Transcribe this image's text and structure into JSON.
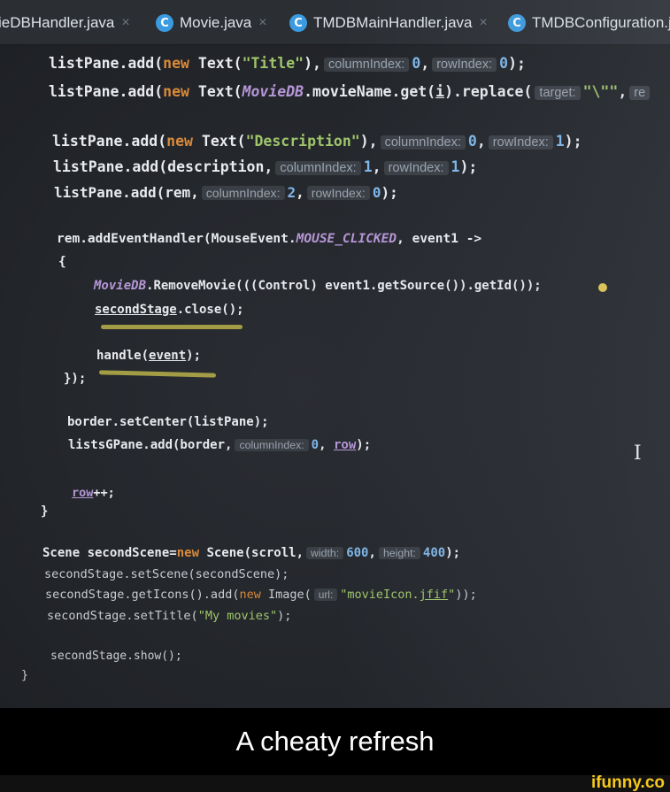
{
  "tabs": [
    {
      "label": "ieDBHandler.java"
    },
    {
      "icon": "C",
      "label": "Movie.java"
    },
    {
      "icon": "C",
      "label": "TMDBMainHandler.java"
    },
    {
      "icon": "C",
      "label": "TMDBConfiguration.j"
    }
  ],
  "tab_close": "×",
  "code": {
    "l1": {
      "a": "listPane.add(",
      "kw": "new",
      "b": " Text(",
      "s": "\"Title\"",
      "c": "),",
      "h1": "columnIndex:",
      "n1": "0",
      "d": ",",
      "h2": "rowIndex:",
      "n2": "0",
      "e": ");"
    },
    "l2": {
      "a": "listPane.add(",
      "kw": "new",
      "b": " Text(",
      "it": "MovieDB",
      "c": ".movieName.get(",
      "u": "i",
      "d": ").replace(",
      "h1": "target:",
      "s": "\"\\\"\"",
      "e": ",",
      "h2": "re"
    },
    "l3": {
      "a": "listPane.add(",
      "kw": "new",
      "b": " Text(",
      "s": "\"Description\"",
      "c": "),",
      "h1": "columnIndex:",
      "n1": "0",
      "d": ",",
      "h2": "rowIndex:",
      "n2": "1",
      "e": ");"
    },
    "l4": {
      "a": "listPane.add(description,",
      "h1": "columnIndex:",
      "n1": "1",
      "b": ",",
      "h2": "rowIndex:",
      "n2": "1",
      "e": ");"
    },
    "l5": {
      "a": "listPane.add(rem,",
      "h1": "columnIndex:",
      "n1": "2",
      "b": ",",
      "h2": "rowIndex:",
      "n2": "0",
      "e": ");"
    },
    "l6": {
      "a": "rem.addEventHandler(MouseEvent.",
      "it": "MOUSE_CLICKED",
      "b": ", event1 ->"
    },
    "l7": "{",
    "l8": {
      "it": "MovieDB",
      "a": ".RemoveMovie(((Control) event1.getSource()).getId());"
    },
    "l9": {
      "u": "secondStage",
      "a": ".close();"
    },
    "l10": {
      "a": "handle(",
      "u": "event",
      "b": ");"
    },
    "l11": "});",
    "l12": "border.setCenter(listPane);",
    "l13": {
      "a": "listsGPane.add(border,",
      "h1": "columnIndex:",
      "n1": "0",
      "b": ",",
      "u": "row",
      "c": ");"
    },
    "l14": {
      "u": "row",
      "a": "++;"
    },
    "l15": "}",
    "l16": {
      "a": "Scene secondScene=",
      "kw": "new",
      "b": " Scene(scroll,",
      "h1": "width:",
      "n1": "600",
      "c": ",",
      "h2": "height:",
      "n2": "400",
      "d": ");"
    },
    "l17": "secondStage.setScene(secondScene);",
    "l18": {
      "a": "secondStage.getIcons().add(",
      "kw": "new",
      "b": " Image(",
      "h1": "url:",
      "s1": "\"movieIcon.",
      "su": "jfif",
      "s2": "\"",
      "c": "));"
    },
    "l19": {
      "a": "secondStage.setTitle(",
      "s": "\"My movies\"",
      "b": ");"
    },
    "l20": "secondStage.show();",
    "l21": "}"
  },
  "cursor_glyph": "I",
  "caption": "A cheaty refresh",
  "watermark": "ifunny.co"
}
